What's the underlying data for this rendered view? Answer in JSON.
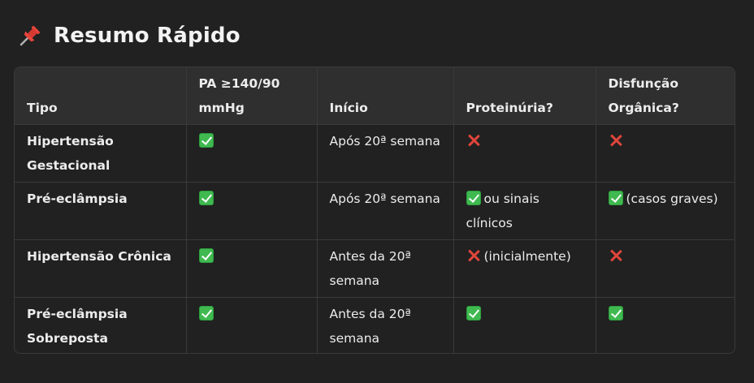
{
  "heading": {
    "icon": "pushpin-icon",
    "title": "Resumo Rápido"
  },
  "table": {
    "headers": [
      "Tipo",
      "PA ≥140/90 mmHg",
      "Início",
      "Proteinúria?",
      "Disfunção Orgânica?"
    ],
    "rows": [
      {
        "tipo": "Hipertensão Gestacional",
        "pa": {
          "icon": "check-icon",
          "text": ""
        },
        "inicio": "Após 20ª semana",
        "proteinuria": {
          "icon": "cross-icon",
          "text": ""
        },
        "disfuncao": {
          "icon": "cross-icon",
          "text": ""
        }
      },
      {
        "tipo": "Pré-eclâmpsia",
        "pa": {
          "icon": "check-icon",
          "text": ""
        },
        "inicio": "Após 20ª semana",
        "proteinuria": {
          "icon": "check-icon",
          "text": "ou sinais clínicos"
        },
        "disfuncao": {
          "icon": "check-icon",
          "text": "(casos graves)"
        }
      },
      {
        "tipo": "Hipertensão Crônica",
        "pa": {
          "icon": "check-icon",
          "text": ""
        },
        "inicio": "Antes da 20ª semana",
        "proteinuria": {
          "icon": "cross-icon",
          "text": "(inicialmente)"
        },
        "disfuncao": {
          "icon": "cross-icon",
          "text": ""
        }
      },
      {
        "tipo": "Pré-eclâmpsia Sobreposta",
        "pa": {
          "icon": "check-icon",
          "text": ""
        },
        "inicio": "Antes da 20ª semana",
        "proteinuria": {
          "icon": "check-icon",
          "text": ""
        },
        "disfuncao": {
          "icon": "check-icon",
          "text": ""
        }
      }
    ]
  },
  "colors": {
    "background": "#212121",
    "header_bg": "#2f2f2f",
    "check": "#3fb950",
    "cross": "#e0453a"
  }
}
